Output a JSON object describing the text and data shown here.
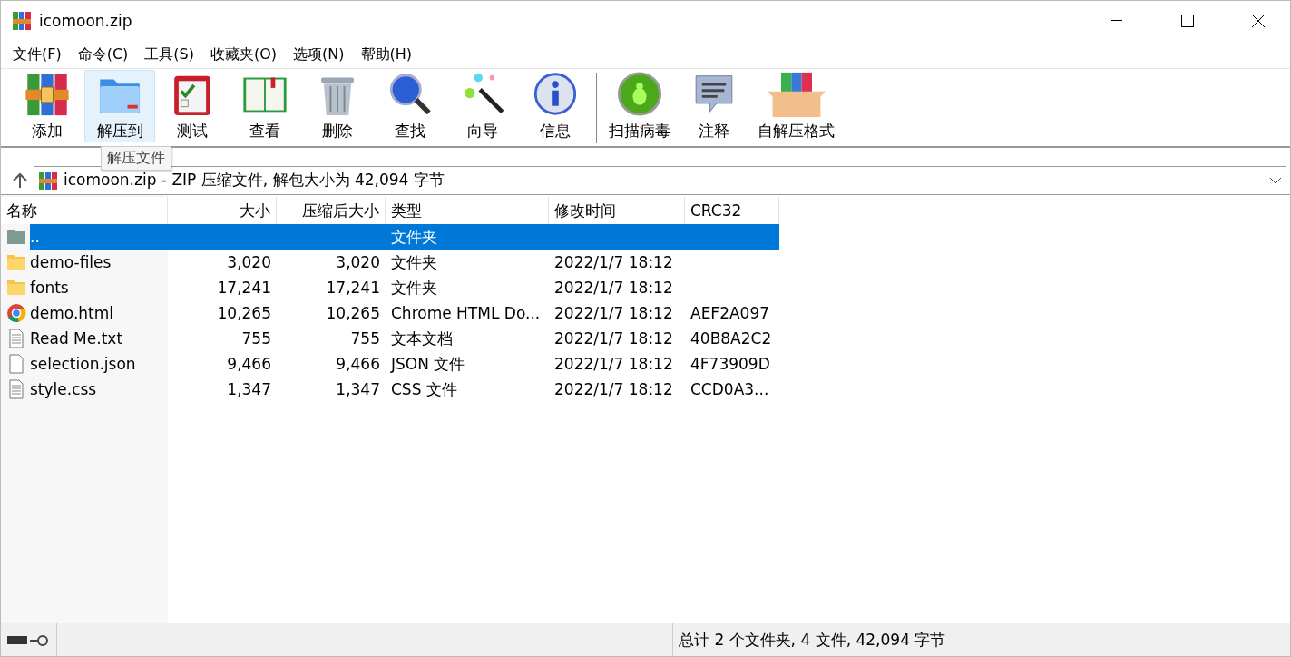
{
  "window": {
    "title": "icomoon.zip"
  },
  "menu": [
    "文件(F)",
    "命令(C)",
    "工具(S)",
    "收藏夹(O)",
    "选项(N)",
    "帮助(H)"
  ],
  "toolbar": [
    {
      "label": "添加",
      "hovered": false
    },
    {
      "label": "解压到",
      "hovered": true
    },
    {
      "label": "测试",
      "hovered": false
    },
    {
      "label": "查看",
      "hovered": false
    },
    {
      "label": "删除",
      "hovered": false
    },
    {
      "label": "查找",
      "hovered": false
    },
    {
      "label": "向导",
      "hovered": false
    },
    {
      "label": "信息",
      "hovered": false
    },
    {
      "label": "扫描病毒",
      "hovered": false,
      "separator_before": true
    },
    {
      "label": "注释",
      "hovered": false
    },
    {
      "label": "自解压格式",
      "hovered": false
    }
  ],
  "tooltip": "解压文件",
  "address": {
    "text": "icomoon.zip - ZIP 压缩文件, 解包大小为 42,094 字节"
  },
  "table": {
    "columns": [
      "名称",
      "大小",
      "压缩后大小",
      "类型",
      "修改时间",
      "CRC32"
    ],
    "rows": [
      {
        "kind": "parent",
        "name": "..",
        "size": "",
        "packed": "",
        "type": "文件夹",
        "modified": "",
        "crc": "",
        "selected": true
      },
      {
        "kind": "folder",
        "name": "demo-files",
        "size": "3,020",
        "packed": "3,020",
        "type": "文件夹",
        "modified": "2022/1/7 18:12",
        "crc": "",
        "selected": false
      },
      {
        "kind": "folder",
        "name": "fonts",
        "size": "17,241",
        "packed": "17,241",
        "type": "文件夹",
        "modified": "2022/1/7 18:12",
        "crc": "",
        "selected": false
      },
      {
        "kind": "chrome",
        "name": "demo.html",
        "size": "10,265",
        "packed": "10,265",
        "type": "Chrome HTML Do...",
        "modified": "2022/1/7 18:12",
        "crc": "AEF2A097",
        "selected": false
      },
      {
        "kind": "text",
        "name": "Read Me.txt",
        "size": "755",
        "packed": "755",
        "type": "文本文档",
        "modified": "2022/1/7 18:12",
        "crc": "40B8A2C2",
        "selected": false
      },
      {
        "kind": "file",
        "name": "selection.json",
        "size": "9,466",
        "packed": "9,466",
        "type": "JSON 文件",
        "modified": "2022/1/7 18:12",
        "crc": "4F73909D",
        "selected": false
      },
      {
        "kind": "text",
        "name": "style.css",
        "size": "1,347",
        "packed": "1,347",
        "type": "CSS 文件",
        "modified": "2022/1/7 18:12",
        "crc": "CCD0A3...",
        "selected": false
      }
    ]
  },
  "status_bar": {
    "text": "总计 2 个文件夹, 4 文件, 42,094 字节"
  }
}
